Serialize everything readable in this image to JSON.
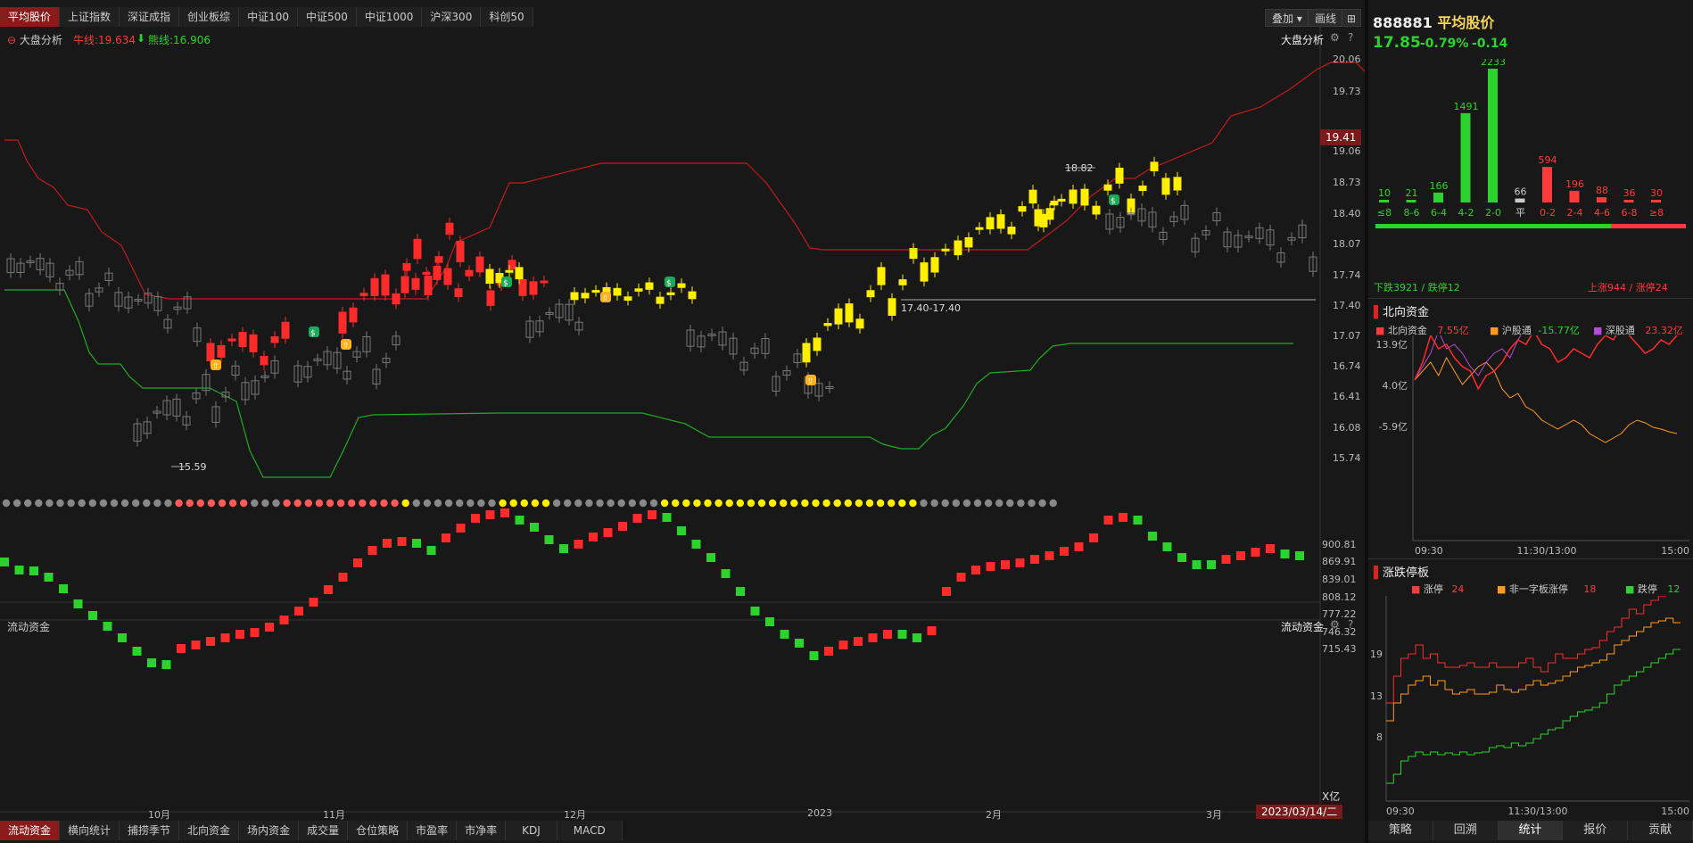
{
  "top_tabs": [
    "平均股价",
    "上证指数",
    "深证成指",
    "创业板综",
    "中证100",
    "中证500",
    "中证1000",
    "沪深300",
    "科创50"
  ],
  "toolbar": {
    "overlay": "叠加",
    "draw": "画线"
  },
  "main_chart": {
    "indicator_name": "大盘分析",
    "bull_line": "牛线:19.634",
    "bear_line": "熊线:16.906",
    "right_label": "大盘分析",
    "price_tag": "19.41",
    "y_ticks": [
      "20.06",
      "19.73",
      "19.06",
      "18.73",
      "18.40",
      "18.07",
      "17.74",
      "17.40",
      "17.07",
      "16.74",
      "16.41",
      "16.08",
      "15.74"
    ],
    "annotations": {
      "high": "18.82",
      "low": "15.59",
      "level": "17.40-17.40"
    }
  },
  "sub_chart": {
    "name": "流动资金",
    "right_label": "流动资金",
    "unit": "X亿",
    "y_ticks": [
      "900.81",
      "869.91",
      "839.01",
      "808.12",
      "777.22",
      "746.32",
      "715.43"
    ]
  },
  "x_axis": {
    "labels": [
      "10月",
      "11月",
      "12月",
      "2023",
      "2月",
      "3月"
    ],
    "current_date": "2023/03/14/二"
  },
  "bottom_tabs": [
    "流动资金",
    "横向统计",
    "捕捞季节",
    "北向资金",
    "场内资金",
    "成交量",
    "仓位策略",
    "市盈率",
    "市净率",
    "KDJ",
    "MACD"
  ],
  "info": {
    "code": "888881",
    "name": "平均股价",
    "price": "17.85",
    "change_pct": "-0.79%",
    "change": "-0.14"
  },
  "distribution": {
    "categories": [
      "≤8",
      "8-6",
      "6-4",
      "4-2",
      "2-0",
      "平",
      "0-2",
      "2-4",
      "4-6",
      "6-8",
      "≥8"
    ],
    "values": [
      10,
      21,
      166,
      1491,
      2233,
      66,
      594,
      196,
      88,
      36,
      30
    ],
    "down_text": "下跌3921 / 跌停12",
    "up_text": "上涨944 / 涨停24"
  },
  "north": {
    "title": "北向资金",
    "legend": [
      {
        "name": "北向资金",
        "value": "7.55亿"
      },
      {
        "name": "沪股通",
        "value": "-15.77亿"
      },
      {
        "name": "深股通",
        "value": "23.32亿"
      }
    ],
    "y_ticks": [
      "13.9亿",
      "4.0亿",
      "-5.9亿"
    ],
    "x_ticks": [
      "09:30",
      "11:30/13:00",
      "15:00"
    ]
  },
  "limit": {
    "title": "涨跌停板",
    "legend": [
      {
        "name": "涨停",
        "value": "24"
      },
      {
        "name": "非一字板涨停",
        "value": "18"
      },
      {
        "name": "跌停",
        "value": "12"
      }
    ],
    "y_ticks": [
      "19",
      "13",
      "8"
    ],
    "x_ticks": [
      "09:30",
      "11:30/13:00",
      "15:00"
    ]
  },
  "right_tabs": [
    "策略",
    "回溯",
    "统计",
    "报价",
    "贡献"
  ],
  "colors": {
    "up": "#ff2a2a",
    "down": "#2cd32c",
    "bull": "#c41b1b",
    "bear": "#22aa22",
    "highlight": "#ffee00"
  }
}
